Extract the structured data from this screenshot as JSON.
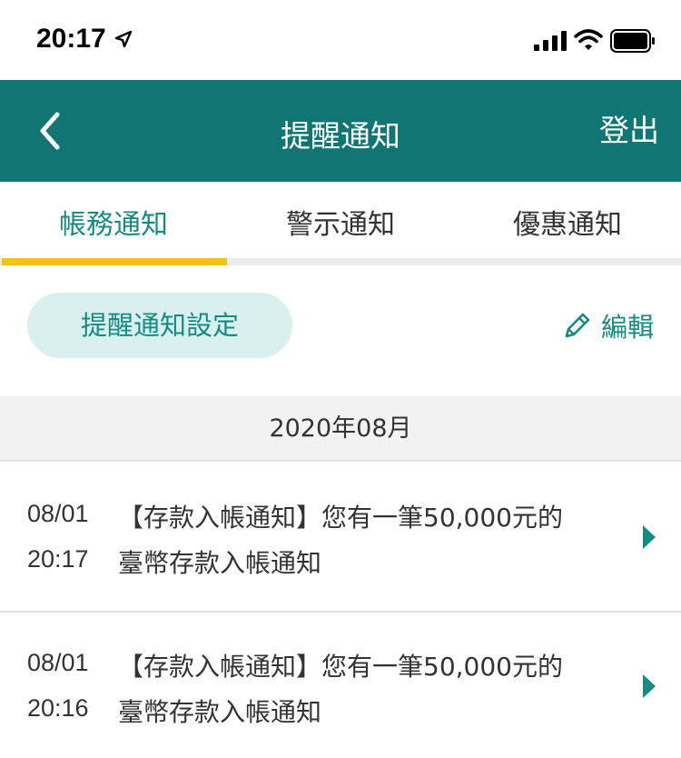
{
  "status_bar": {
    "time": "20:17",
    "icons": [
      "location-arrow-icon",
      "signal-icon",
      "wifi-icon",
      "battery-icon"
    ]
  },
  "header": {
    "back_icon": "chevron-left-icon",
    "title": "提醒通知",
    "logout_label": "登出",
    "bg_color": "#117673"
  },
  "tabs": [
    {
      "label": "帳務通知",
      "active": true
    },
    {
      "label": "警示通知",
      "active": false
    },
    {
      "label": "優惠通知",
      "active": false
    }
  ],
  "tab_indicator_color": "#f2c315",
  "actions": {
    "settings_label": "提醒通知設定",
    "edit_label": "編輯",
    "edit_icon": "pencil-icon",
    "accent_color": "#188a84"
  },
  "month_header": "2020年08月",
  "notifications": [
    {
      "date": "08/01",
      "time": "20:17",
      "line1": "【存款入帳通知】您有一筆50,000元的",
      "line2": "臺幣存款入帳通知"
    },
    {
      "date": "08/01",
      "time": "20:16",
      "line1": "【存款入帳通知】您有一筆50,000元的",
      "line2": "臺幣存款入帳通知"
    }
  ]
}
